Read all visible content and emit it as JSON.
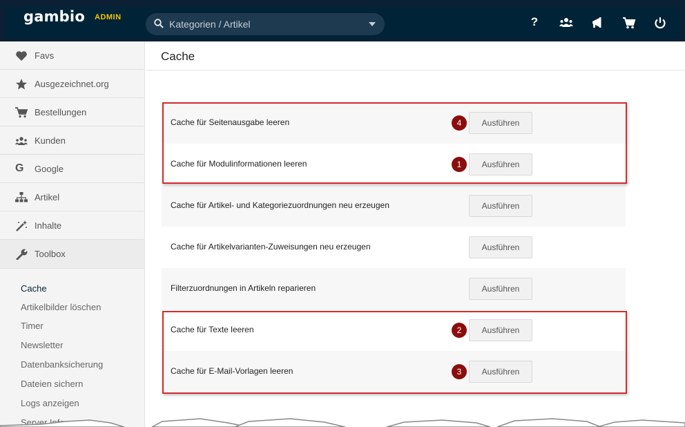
{
  "topbar": {
    "logo_text": "gambio",
    "logo_badge": "ADMIN",
    "search_placeholder": "Kategorien / Artikel",
    "icons": [
      "help-icon",
      "users-icon",
      "megaphone-icon",
      "cart-icon",
      "power-icon"
    ],
    "help_glyph": "?"
  },
  "sidebar": {
    "items": [
      {
        "label": "Favs",
        "icon": "heart-icon"
      },
      {
        "label": "Ausgezeichnet.org",
        "icon": "star-icon"
      },
      {
        "label": "Bestellungen",
        "icon": "cart-icon"
      },
      {
        "label": "Kunden",
        "icon": "users-icon"
      },
      {
        "label": "Google",
        "icon": "google-icon",
        "glyph": "G"
      },
      {
        "label": "Artikel",
        "icon": "sitemap-icon"
      },
      {
        "label": "Inhalte",
        "icon": "magic-wand-icon"
      },
      {
        "label": "Toolbox",
        "icon": "wrench-icon"
      }
    ],
    "sub_items": [
      "Cache",
      "Artikelbilder löschen",
      "Timer",
      "Newsletter",
      "Datenbanksicherung",
      "Dateien sichern",
      "Logs anzeigen",
      "Server Info"
    ]
  },
  "page": {
    "title": "Cache"
  },
  "cache_rows": [
    {
      "label": "Cache für Seitenausgabe leeren",
      "button": "Ausführen",
      "step": "4"
    },
    {
      "label": "Cache für Modulinformationen leeren",
      "button": "Ausführen",
      "step": "1"
    },
    {
      "label": "Cache für Artikel- und Kategoriezuordnungen neu erzeugen",
      "button": "Ausführen",
      "step": ""
    },
    {
      "label": "Cache für Artikelvarianten-Zuweisungen neu erzeugen",
      "button": "Ausführen",
      "step": ""
    },
    {
      "label": "Filterzuordnungen in Artikeln reparieren",
      "button": "Ausführen",
      "step": ""
    },
    {
      "label": "Cache für Texte leeren",
      "button": "Ausführen",
      "step": "2"
    },
    {
      "label": "Cache für E-Mail-Vorlagen leeren",
      "button": "Ausführen",
      "step": "3"
    }
  ],
  "colors": {
    "topbar": "#002337",
    "accent": "#f7c30a",
    "highlight": "#d42b2b",
    "step_badge": "#8b0d0d"
  }
}
